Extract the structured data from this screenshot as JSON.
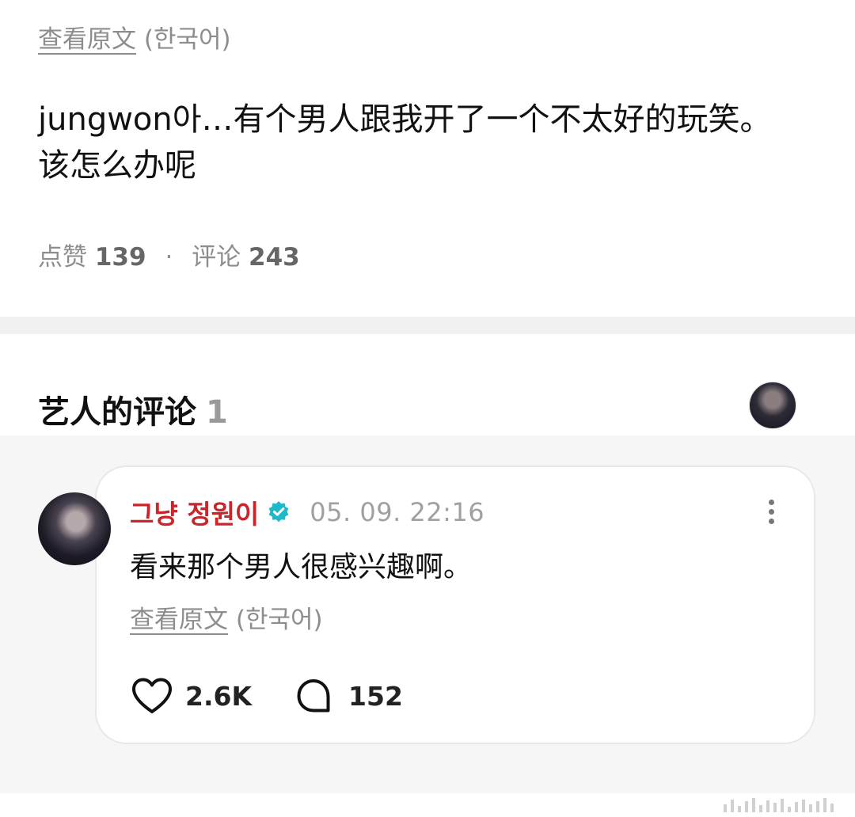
{
  "post": {
    "view_original_link": "查看原文",
    "view_original_lang": "(한국어)",
    "body_line1": "jungwon아…有个男人跟我开了一个不太好的玩笑。",
    "body_line2": "该怎么办呢",
    "likes_label": "点赞",
    "likes_count": "139",
    "separator": "·",
    "comments_label": "评论",
    "comments_count": "243"
  },
  "artist_comments": {
    "title": "艺人的评论",
    "count": "1"
  },
  "comment": {
    "author": "그냥 정원이",
    "verified_icon": "verified-badge-icon",
    "timestamp": "05. 09. 22:16",
    "text": "看来那个男人很感兴趣啊。",
    "view_original_link": "查看原文",
    "view_original_lang": "(한국어)",
    "like_icon": "heart-icon",
    "like_count": "2.6K",
    "reply_icon": "speech-bubble-icon",
    "reply_count": "152"
  },
  "colors": {
    "author_name": "#c8262b",
    "verified_badge": "#1fb8c9",
    "muted_text": "#8d8d8d",
    "background_gray": "#f6f6f6"
  }
}
